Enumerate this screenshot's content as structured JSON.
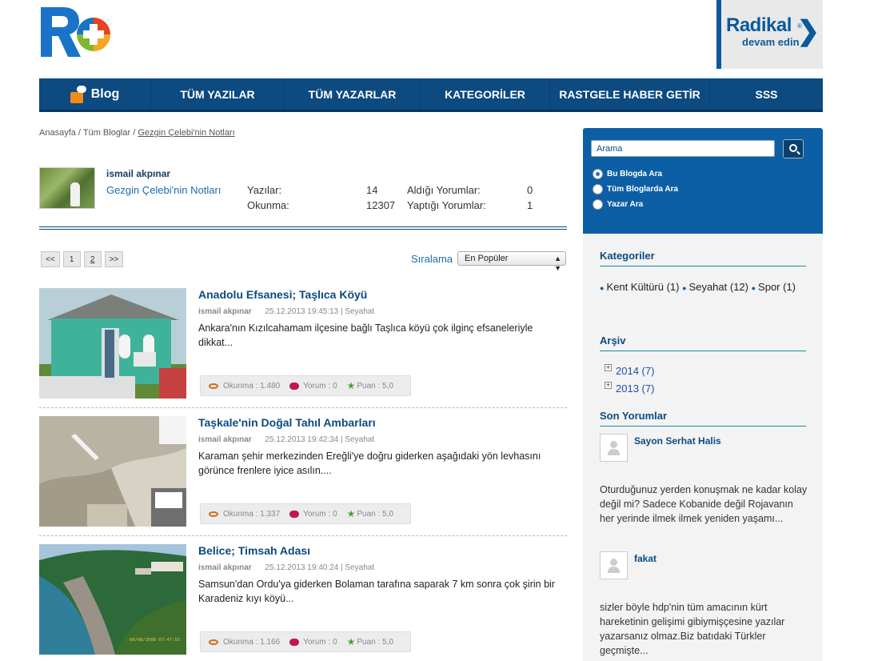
{
  "header": {
    "radikal_title": "Radikal",
    "radikal_reg": "®",
    "radikal_sub": "devam edin"
  },
  "nav": {
    "blog": "Blog",
    "items": [
      "TÜM YAZILAR",
      "TÜM YAZARLAR",
      "KATEGORİLER",
      "RASTGELE HABER GETİR",
      "SSS"
    ]
  },
  "breadcrumb": [
    "Anasayfa",
    "Tüm Bloglar",
    "Gezgin Çelebi'nin Notları"
  ],
  "author": {
    "name": "ismail akpınar",
    "blog": "Gezgin Çelebi'nin Notları",
    "stats": [
      {
        "label": "Yazılar:",
        "value": "14"
      },
      {
        "label": "Aldığı Yorumlar:",
        "value": "0"
      },
      {
        "label": "Okunma:",
        "value": "12307"
      },
      {
        "label": "Yaptığı Yorumlar:",
        "value": "1"
      }
    ]
  },
  "pager": [
    "<<",
    "1",
    "2",
    ">>"
  ],
  "sort": {
    "label": "Sıralama",
    "selected": "En Popüler"
  },
  "posts": [
    {
      "title": "Anadolu Efsanesi; Taşlıca Köyü",
      "author": "ismail akpınar",
      "date": "25.12.2013 19:45:13",
      "category": "Seyahat",
      "excerpt": "Ankara'nın Kızılcahamam ilçesine bağlı Taşlıca köyü çok ilginç efsaneleriyle dikkat...",
      "views": "Okunma : 1.480",
      "comments": "Yorum : 0",
      "score": "Puan : 5,0"
    },
    {
      "title": "Taşkale'nin Doğal Tahıl Ambarları",
      "author": "ismail akpınar",
      "date": "25.12.2013 19:42:34",
      "category": "Seyahat",
      "excerpt": "Karaman şehir merkezinden Ereğli'ye doğru giderken aşağıdaki yön levhasını görünce frenlere iyice asılın....",
      "views": "Okunma : 1.337",
      "comments": "Yorum : 0",
      "score": "Puan : 5,0"
    },
    {
      "title": "Belice; Timsah Adası",
      "author": "ismail akpınar",
      "date": "25.12.2013 19:40:24",
      "category": "Seyahat",
      "excerpt": "Samsun'dan Ordu'ya giderken Bolaman tarafına saparak 7 km sonra çok şirin bir Karadeniz kıyı köyü...",
      "views": "Okunma : 1.166",
      "comments": "Yorum : 0",
      "score": "Puan : 5,0",
      "photo_stamp": "09/08/2008 07:47:55"
    }
  ],
  "search": {
    "placeholder": "Arama",
    "options": [
      "Bu Blogda Ara",
      "Tüm Bloglarda Ara",
      "Yazar Ara"
    ],
    "selected": 0
  },
  "sidebar": {
    "categories_title": "Kategoriler",
    "categories": [
      "Kent Kültürü (1)",
      "Seyahat (12)",
      "Spor (1)"
    ],
    "archive_title": "Arşiv",
    "archive": [
      "2014 (7)",
      "2013 (7)"
    ],
    "comments_title": "Son Yorumlar",
    "comments": [
      {
        "name": "Sayon Serhat Halis",
        "text": "Oturduğunuz yerden konuşmak ne kadar kolay değil mi? Sadece Kobanide değil Rojavanın her yerinde ilmek ilmek yeniden yaşamı..."
      },
      {
        "name": "fakat",
        "text": "sizler böyle hdp'nin tüm amacının kürt hareketinin gelişimi gibiymişçesine yazılar yazarsanız olmaz.Biz batıdaki Türkler geçmişte..."
      }
    ]
  },
  "colors": {
    "nav": "#0c4a80",
    "accent": "#0c5fa4",
    "link": "#1a6db0"
  }
}
